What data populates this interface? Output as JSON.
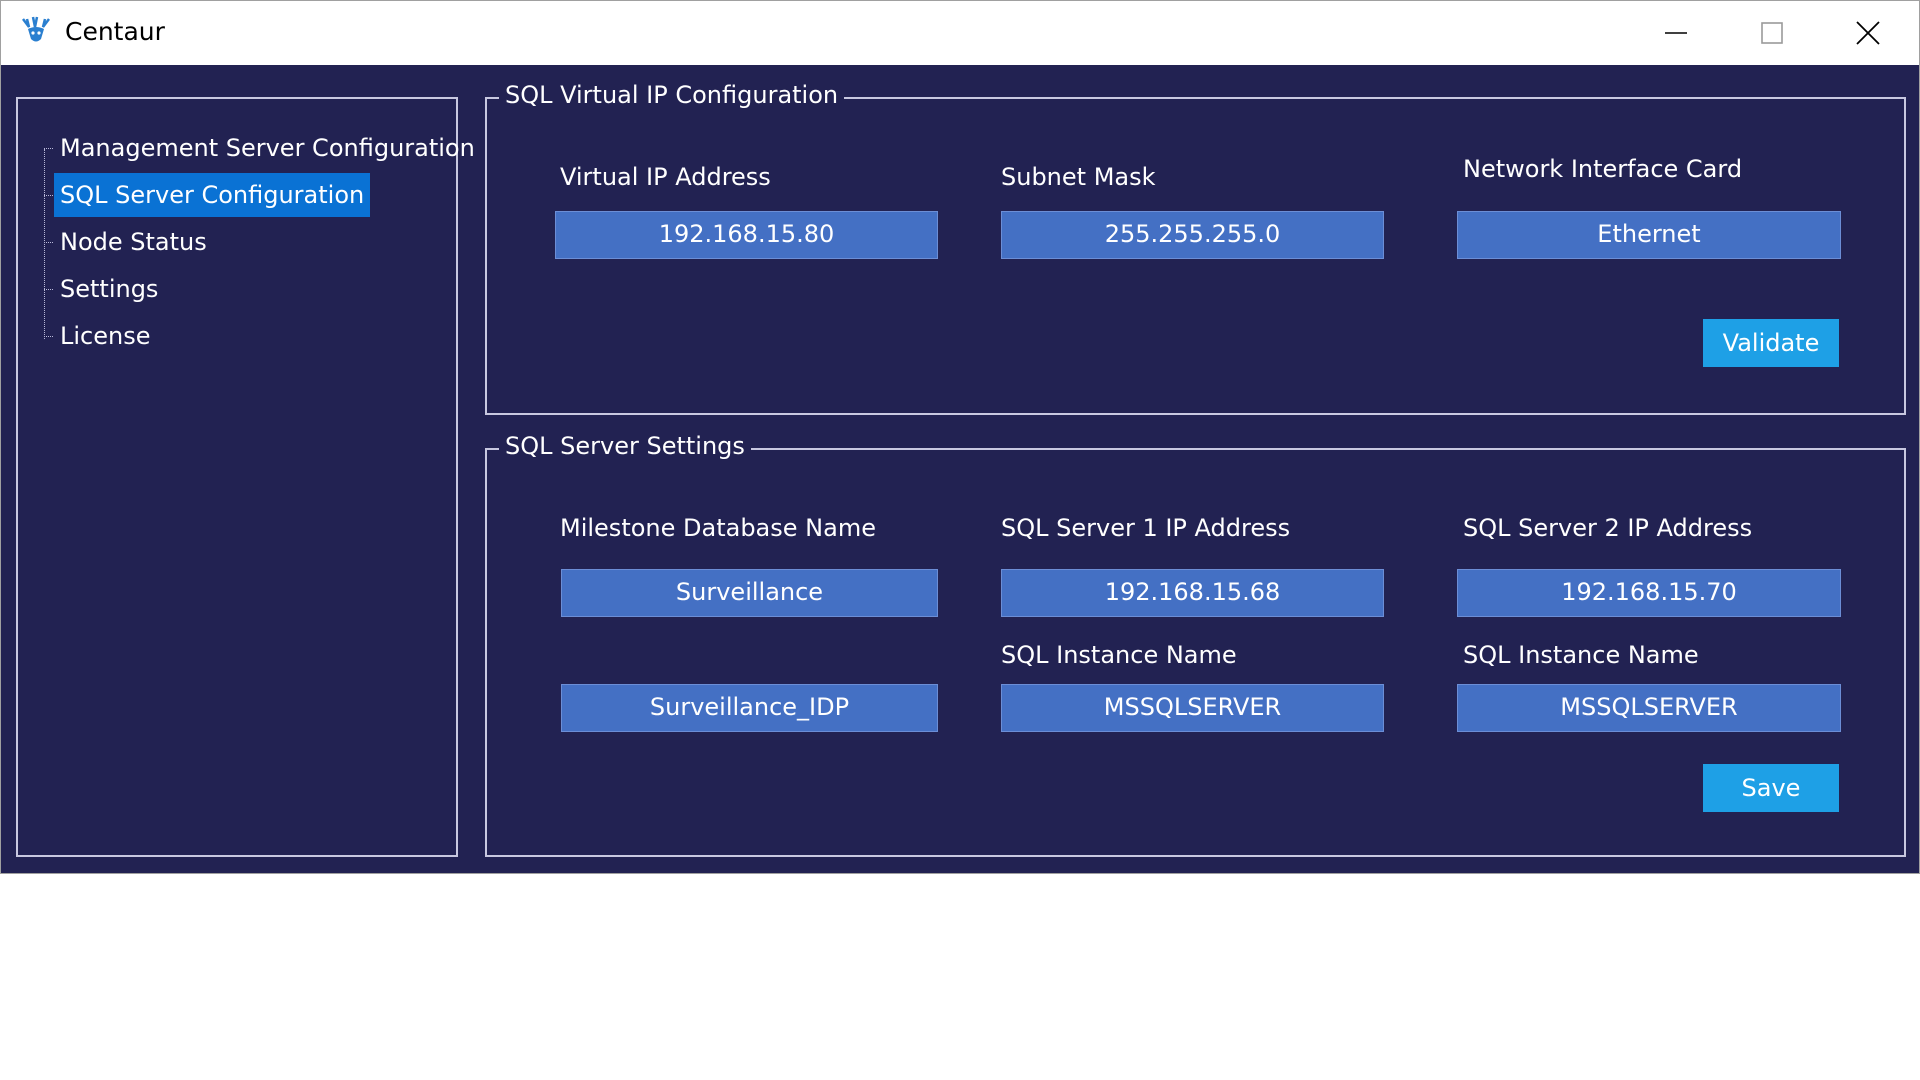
{
  "window": {
    "title": "Centaur"
  },
  "titlebar": {
    "app_icon": "centaur-logo-icon",
    "minimize_icon": "minimize-icon",
    "maximize_icon": "maximize-icon",
    "close_icon": "close-icon"
  },
  "sidebar": {
    "items": [
      {
        "label": "Management Server Configuration",
        "selected": false
      },
      {
        "label": "SQL Server Configuration",
        "selected": true
      },
      {
        "label": "Node Status",
        "selected": false
      },
      {
        "label": "Settings",
        "selected": false
      },
      {
        "label": "License",
        "selected": false
      }
    ]
  },
  "vip": {
    "title": "SQL Virtual IP Configuration",
    "ip_label": "Virtual IP Address",
    "ip_value": "192.168.15.80",
    "subnet_label": "Subnet Mask",
    "subnet_value": "255.255.255.0",
    "nic_label": "Network Interface Card",
    "nic_value": "Ethernet",
    "validate_label": "Validate"
  },
  "sql": {
    "title": "SQL Server Settings",
    "db_label": "Milestone Database Name",
    "db_value": "Surveillance",
    "db2_value": "Surveillance_IDP",
    "server1_label": "SQL Server 1 IP Address",
    "server1_value": "192.168.15.68",
    "server2_label": "SQL Server 2 IP Address",
    "server2_value": "192.168.15.70",
    "instance1_label": "SQL Instance Name",
    "instance1_value": "MSSQLSERVER",
    "instance2_label": "SQL Instance Name",
    "instance2_value": "MSSQLSERVER",
    "save_label": "Save"
  },
  "colors": {
    "background": "#222252",
    "selection": "#0a72d4",
    "field": "#4470c4",
    "button": "#1ea0e6"
  }
}
